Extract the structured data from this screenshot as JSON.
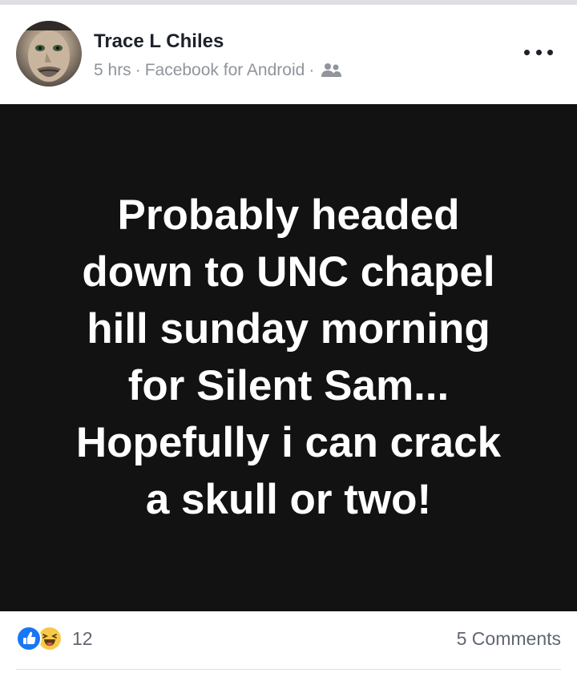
{
  "post": {
    "author": "Trace L Chiles",
    "time": "5 hrs",
    "separator": "·",
    "source": "Facebook for Android",
    "audience_icon": "friends-icon",
    "more_icon": "more-options-icon",
    "image_text_lines": [
      "Probably headed",
      "down to UNC chapel",
      "hill sunday morning",
      "for Silent Sam...",
      "Hopefully i can crack",
      "a skull or two!"
    ]
  },
  "reactions": {
    "icons": [
      "like-icon",
      "haha-icon"
    ],
    "count": "12"
  },
  "comments": {
    "label": "5 Comments"
  },
  "colors": {
    "author": "#1d2129",
    "meta": "#90949c",
    "image_background": "#121212",
    "image_text": "#ffffff",
    "like_blue": "#1877f2",
    "haha_yellow": "#f7c94b"
  }
}
